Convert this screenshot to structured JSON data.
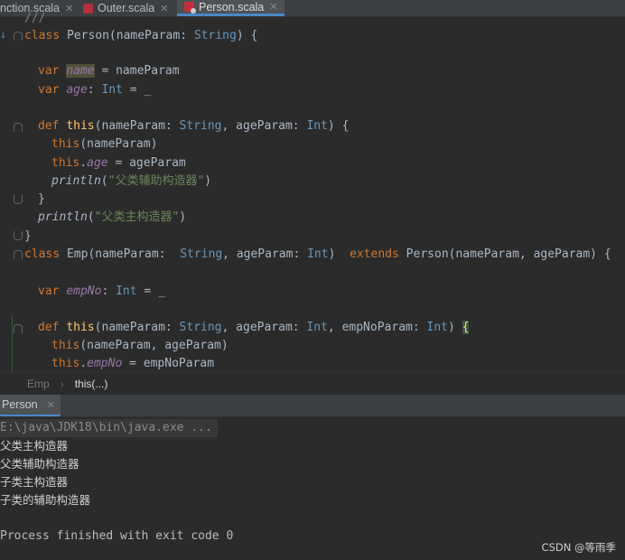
{
  "tabs": [
    {
      "label": "nction.scala",
      "active": false
    },
    {
      "label": "Outer.scala",
      "active": false
    },
    {
      "label": "Person.scala",
      "active": true
    }
  ],
  "editor": {
    "partial_top": "///",
    "lines": {
      "l1_kw": "class",
      "l1_name": "Person(nameParam: ",
      "l1_type": "String",
      "l1_end": ") {",
      "l2_kw": "var ",
      "l2_field": "name",
      "l2_rest": " = nameParam",
      "l3_kw": "var ",
      "l3_field": "age",
      "l3_colon": ": ",
      "l3_type": "Int",
      "l3_rest": " = _",
      "l4_kw": "def ",
      "l4_fn": "this",
      "l4_a": "(nameParam: ",
      "l4_t1": "String",
      "l4_b": ", ageParam: ",
      "l4_t2": "Int",
      "l4_end": ") {",
      "l5_kw": "this",
      "l5_rest": "(nameParam)",
      "l6_kw": "this",
      "l6_dot": ".",
      "l6_field": "age",
      "l6_rest": " = ageParam",
      "l7_fn": "println",
      "l7_open": "(",
      "l7_str": "\"父类辅助构造器\"",
      "l7_close": ")",
      "l8": "}",
      "l9_fn": "println",
      "l9_open": "(",
      "l9_str": "\"父类主构造器\"",
      "l9_close": ")",
      "l10": "}",
      "l11_kw": "class",
      "l11_name": " Emp(nameParam:  ",
      "l11_t1": "String",
      "l11_b": ", ageParam: ",
      "l11_t2": "Int",
      "l11_c": ")  ",
      "l11_ext": "extends",
      "l11_rest": " Person(nameParam, ageParam) {",
      "l12_kw": "var ",
      "l12_field": "empNo",
      "l12_colon": ": ",
      "l12_type": "Int",
      "l12_rest": " = _",
      "l13_kw": "def ",
      "l13_fn": "this",
      "l13_a": "(nameParam: ",
      "l13_t1": "String",
      "l13_b": ", ageParam: ",
      "l13_t2": "Int",
      "l13_c": ", empNoParam: ",
      "l13_t3": "Int",
      "l13_d": ") ",
      "l13_brace": "{",
      "l14_kw": "this",
      "l14_rest": "(nameParam, ageParam)",
      "l15_kw": "this",
      "l15_dot": ".",
      "l15_field": "empNo",
      "l15_rest": " = empNoParam"
    }
  },
  "breadcrumb": {
    "parent": "Emp",
    "separator": "›",
    "current": "this(...)"
  },
  "run": {
    "tab_label": "Person",
    "command": "E:\\java\\JDK18\\bin\\java.exe ...",
    "output": [
      "父类主构造器",
      "父类辅助构造器",
      "子类主构造器",
      "子类的辅助构造器"
    ],
    "exit": "Process finished with exit code 0"
  },
  "watermark": "CSDN @等雨季",
  "colors": {
    "keyword": "#cc7832",
    "type": "#6897bb",
    "field": "#9876aa",
    "string": "#6a8759",
    "function": "#ffc66d",
    "background": "#2b2b2b"
  }
}
